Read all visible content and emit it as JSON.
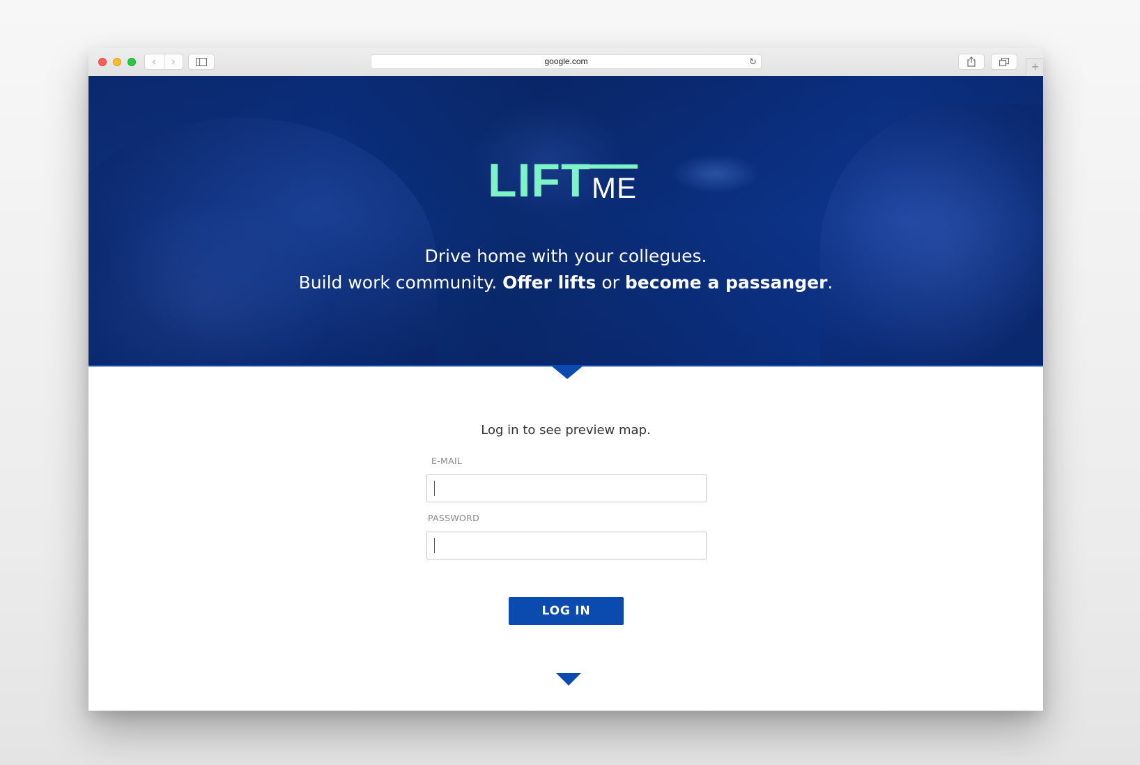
{
  "browser": {
    "url": "google.com",
    "back_icon": "‹",
    "forward_icon": "›",
    "reload_icon": "↻",
    "new_tab_icon": "+"
  },
  "hero": {
    "logo_primary": "LIFT",
    "logo_secondary": "ME",
    "tagline_line1": "Drive home with your collegues.",
    "tagline_line2_part1": "Build work community. ",
    "tagline_line2_bold1": "Offer lifts",
    "tagline_line2_part2": " or ",
    "tagline_line2_bold2": "become a passanger",
    "tagline_line2_part3": "."
  },
  "login": {
    "prompt": "Log in to see preview map.",
    "email_label": "E-MAIL",
    "email_value": "",
    "password_label": "PASSWORD",
    "password_value": "",
    "button_label": "LOG IN"
  },
  "colors": {
    "brand_blue": "#0b4bb0",
    "logo_mint": "#7ef3c8",
    "hero_bg": "#0c3386"
  }
}
